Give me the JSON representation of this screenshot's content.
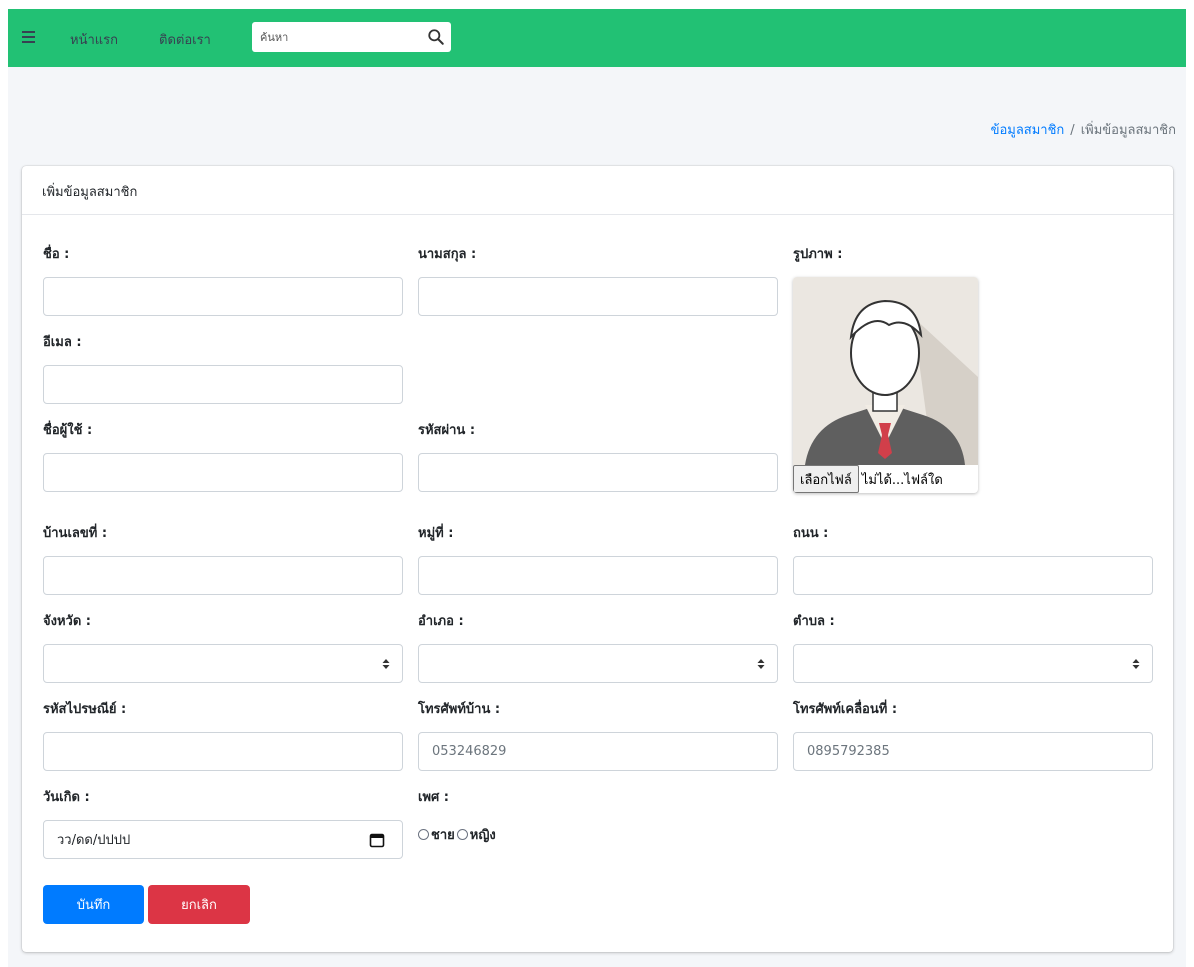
{
  "nav": {
    "home": "หน้าแรก",
    "contact": "ติดต่อเรา",
    "search_placeholder": "ค้นหา"
  },
  "breadcrumb": {
    "parent": "ข้อมูลสมาชิก",
    "current": "เพิ่มข้อมูลสมาชิก"
  },
  "card": {
    "title": "เพิ่มข้อมูลสมาชิก"
  },
  "form": {
    "first_name": "ชื่อ :",
    "last_name": "นามสกุล :",
    "photo": "รูปภาพ :",
    "email": "อีเมล :",
    "username": "ชื่อผู้ใช้ :",
    "password": "รหัสผ่าน :",
    "house_no": "บ้านเลขที่ :",
    "village_no": "หมู่ที่ :",
    "road": "ถนน :",
    "province": "จังหวัด :",
    "district": "อำเภอ :",
    "subdistrict": "ตำบล :",
    "postal_code": "รหัสไปรษณีย์ :",
    "home_phone": "โทรศัพท์บ้าน :",
    "home_phone_placeholder": "053246829",
    "mobile_phone": "โทรศัพท์เคลื่อนที่ :",
    "mobile_phone_placeholder": "0895792385",
    "birthdate": "วันเกิด :",
    "birthdate_value": "วว/ดด/ปปปป",
    "gender": "เพศ :",
    "gender_male": "ชาย",
    "gender_female": "หญิง",
    "file_button": "เลือกไฟล์",
    "file_status": "ไม่ได้...ไฟล์ใด"
  },
  "buttons": {
    "save": "บันทึก",
    "cancel": "ยกเลิก"
  },
  "colors": {
    "navbar": "#22c174",
    "link": "#007bff",
    "save": "#007bff",
    "cancel": "#dc3545"
  }
}
